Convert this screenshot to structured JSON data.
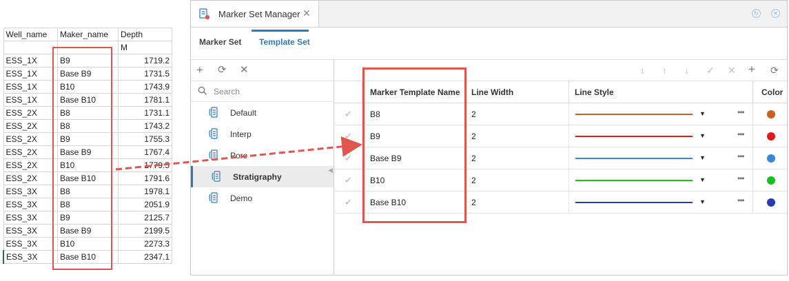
{
  "sheet": {
    "headers": [
      "Well_name",
      "Maker_name",
      "Depth"
    ],
    "unit": "M",
    "rows": [
      [
        "ESS_1X",
        "B9",
        "1719.2"
      ],
      [
        "ESS_1X",
        "Base B9",
        "1731.5"
      ],
      [
        "ESS_1X",
        "B10",
        "1743.9"
      ],
      [
        "ESS_1X",
        "Base B10",
        "1781.1"
      ],
      [
        "ESS_2X",
        "B8",
        "1731.1"
      ],
      [
        "ESS_2X",
        "B8",
        "1743.2"
      ],
      [
        "ESS_2X",
        "B9",
        "1755.3"
      ],
      [
        "ESS_2X",
        "Base B9",
        "1767.4"
      ],
      [
        "ESS_2X",
        "B10",
        "1779.5"
      ],
      [
        "ESS_2X",
        "Base B10",
        "1791.6"
      ],
      [
        "ESS_3X",
        "B8",
        "1978.1"
      ],
      [
        "ESS_3X",
        "B8",
        "2051.9"
      ],
      [
        "ESS_3X",
        "B9",
        "2125.7"
      ],
      [
        "ESS_3X",
        "Base B9",
        "2199.5"
      ],
      [
        "ESS_3X",
        "B10",
        "2273.3"
      ],
      [
        "ESS_3X",
        "Base B10",
        "2347.1"
      ]
    ]
  },
  "window": {
    "title": "Marker Set Manager",
    "close_glyph": "✕",
    "tabs": [
      "Marker Set",
      "Template Set"
    ],
    "active_tab": "Template Set"
  },
  "left_pane": {
    "toolbar_icons": [
      "plus-icon",
      "refresh-icon",
      "close-icon"
    ],
    "search_placeholder": "Search",
    "items": [
      {
        "label": "Default",
        "selected": false
      },
      {
        "label": "Interp",
        "selected": false
      },
      {
        "label": "Pore",
        "selected": false
      },
      {
        "label": "Stratigraphy",
        "selected": true
      },
      {
        "label": "Demo",
        "selected": false
      }
    ]
  },
  "grid": {
    "toolbar_icons": [
      "move-icon",
      "move-up-icon",
      "move-down-icon",
      "confirm-icon",
      "delete-icon",
      "add-icon",
      "refresh-icon"
    ],
    "columns": [
      "Marker Template Name",
      "Line Width",
      "Line Style",
      "Color"
    ],
    "rows": [
      {
        "name": "B8",
        "width": "2",
        "color": "#c8601f"
      },
      {
        "name": "B9",
        "width": "2",
        "color": "#e01b1b"
      },
      {
        "name": "Base B9",
        "width": "2",
        "color": "#3a86d8"
      },
      {
        "name": "B10",
        "width": "2",
        "color": "#18c01e"
      },
      {
        "name": "Base B10",
        "width": "2",
        "color": "#2a3ab0"
      }
    ]
  },
  "colors": {
    "accent": "#2a7ac0",
    "highlight": "#e0564e"
  }
}
